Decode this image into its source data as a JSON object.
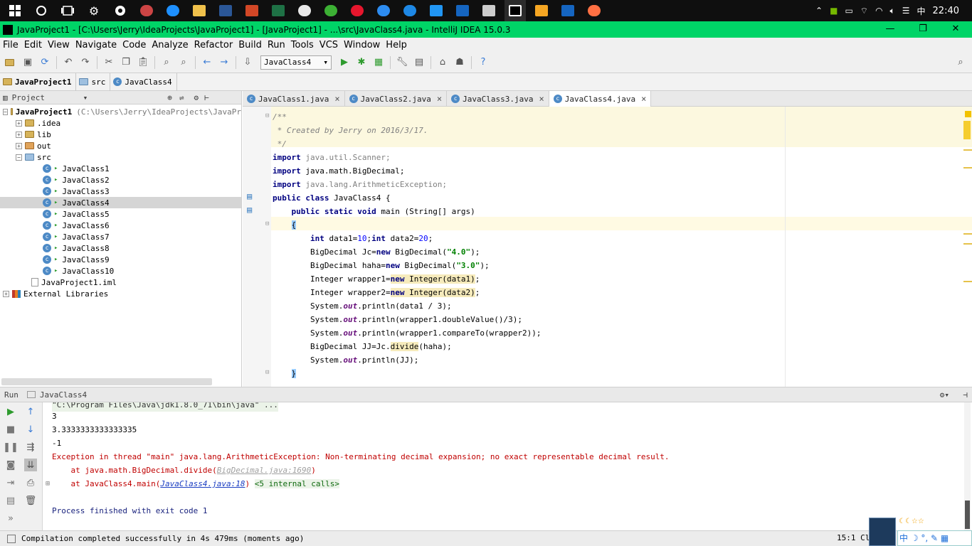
{
  "taskbar": {
    "clock": "22:40",
    "ime": "中",
    "apps": [
      "windows-start",
      "cortana",
      "task-view",
      "settings",
      "chrome",
      "maxthon",
      "ie",
      "explorer",
      "word",
      "powerpoint",
      "excel",
      "qq",
      "wechat",
      "weibo",
      "browser2",
      "player",
      "photo",
      "vm",
      "app2",
      "intellij",
      "app3",
      "mp",
      "app4"
    ]
  },
  "window": {
    "title": "JavaProject1 - [C:\\Users\\Jerry\\IdeaProjects\\JavaProject1] - [JavaProject1] - ...\\src\\JavaClass4.java - IntelliJ IDEA 15.0.3",
    "minimize": "—",
    "maximize": "❐",
    "close": "✕"
  },
  "menu": [
    "File",
    "Edit",
    "View",
    "Navigate",
    "Code",
    "Analyze",
    "Refactor",
    "Build",
    "Run",
    "Tools",
    "VCS",
    "Window",
    "Help"
  ],
  "toolbar": {
    "run_config": "JavaClass4"
  },
  "breadcrumb": [
    "JavaProject1",
    "src",
    "JavaClass4"
  ],
  "project": {
    "header": "Project",
    "root": "JavaProject1",
    "root_path": "(C:\\Users\\Jerry\\IdeaProjects\\JavaPr",
    "folders": [
      ".idea",
      "lib",
      "out",
      "src"
    ],
    "classes": [
      "JavaClass1",
      "JavaClass2",
      "JavaClass3",
      "JavaClass4",
      "JavaClass5",
      "JavaClass6",
      "JavaClass7",
      "JavaClass8",
      "JavaClass9",
      "JavaClass10"
    ],
    "iml": "JavaProject1.iml",
    "ext": "External Libraries"
  },
  "tabs": [
    "JavaClass1.java",
    "JavaClass2.java",
    "JavaClass3.java",
    "JavaClass4.java"
  ],
  "run": {
    "label": "Run",
    "config": "JavaClass4"
  },
  "console": {
    "cmd": "\"C:\\Program Files\\Java\\jdk1.8.0_71\\bin\\java\" ...",
    "out1": "3",
    "out2": "3.3333333333333335",
    "out3": "-1",
    "exc": "Exception in thread \"main\" java.lang.ArithmeticException: Non-terminating decimal expansion; no exact representable decimal result.",
    "at1_pre": "    at java.math.BigDecimal.divide(",
    "at1_link": "BigDecimal.java:1690",
    "at1_post": ")",
    "at2_pre": "    at JavaClass4.main(",
    "at2_link": "JavaClass4.java:18",
    "at2_post": ")",
    "internal": "<5 internal calls>",
    "finished": "Process finished with exit code 1"
  },
  "status": {
    "message": "Compilation completed successfully in 4s 479ms (moments ago)",
    "position": "15:1",
    "extra": "Cl"
  }
}
